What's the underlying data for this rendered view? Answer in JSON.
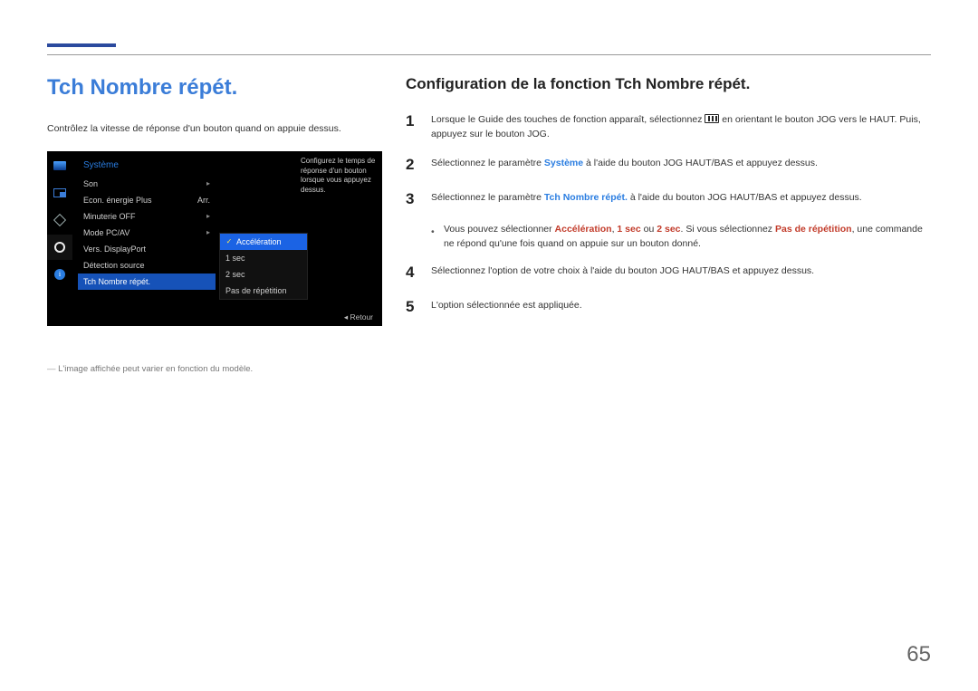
{
  "title": "Tch Nombre répét.",
  "intro": "Contrôlez la vitesse de réponse d'un bouton quand on appuie dessus.",
  "osd": {
    "header": "Système",
    "items": [
      {
        "label": "Son",
        "caret": "▸"
      },
      {
        "label": "Econ. énergie Plus",
        "value": "Arr."
      },
      {
        "label": "Minuterie OFF",
        "caret": "▸"
      },
      {
        "label": "Mode PC/AV",
        "caret": "▸"
      },
      {
        "label": "Vers. DisplayPort"
      },
      {
        "label": "Détection source"
      },
      {
        "label": "Tch Nombre répét."
      }
    ],
    "popup": [
      "Accélération",
      "1 sec",
      "2 sec",
      "Pas de répétition"
    ],
    "desc": "Configurez le temps de réponse d'un bouton lorsque vous appuyez dessus.",
    "retour": "Retour"
  },
  "footnote": "L'image affichée peut varier en fonction du modèle.",
  "section": "Configuration de la fonction Tch Nombre répét.",
  "steps": {
    "s1a": "Lorsque le Guide des touches de fonction apparaît, sélectionnez ",
    "s1b": " en orientant le bouton JOG vers le HAUT. Puis, appuyez sur le bouton JOG.",
    "s2a": "Sélectionnez le paramètre ",
    "s2b": "Système",
    "s2c": " à l'aide du bouton JOG HAUT/BAS et appuyez dessus.",
    "s3a": "Sélectionnez le paramètre ",
    "s3b": "Tch Nombre répét.",
    "s3c": " à l'aide du bouton JOG HAUT/BAS et appuyez dessus.",
    "bul_a": "Vous pouvez sélectionner ",
    "bul_ac": "Accélération",
    "bul_comma1": ", ",
    "bul_1s": "1 sec",
    "bul_or": " ou ",
    "bul_2s": "2 sec",
    "bul_dot1": ". Si vous sélectionnez ",
    "bul_pr": "Pas de répétition",
    "bul_rest": ", une commande ne répond qu'une fois quand on appuie sur un bouton donné.",
    "s4": "Sélectionnez l'option de votre choix à l'aide du bouton JOG HAUT/BAS et appuyez dessus.",
    "s5": "L'option sélectionnée est appliquée."
  },
  "pagenum": "65"
}
